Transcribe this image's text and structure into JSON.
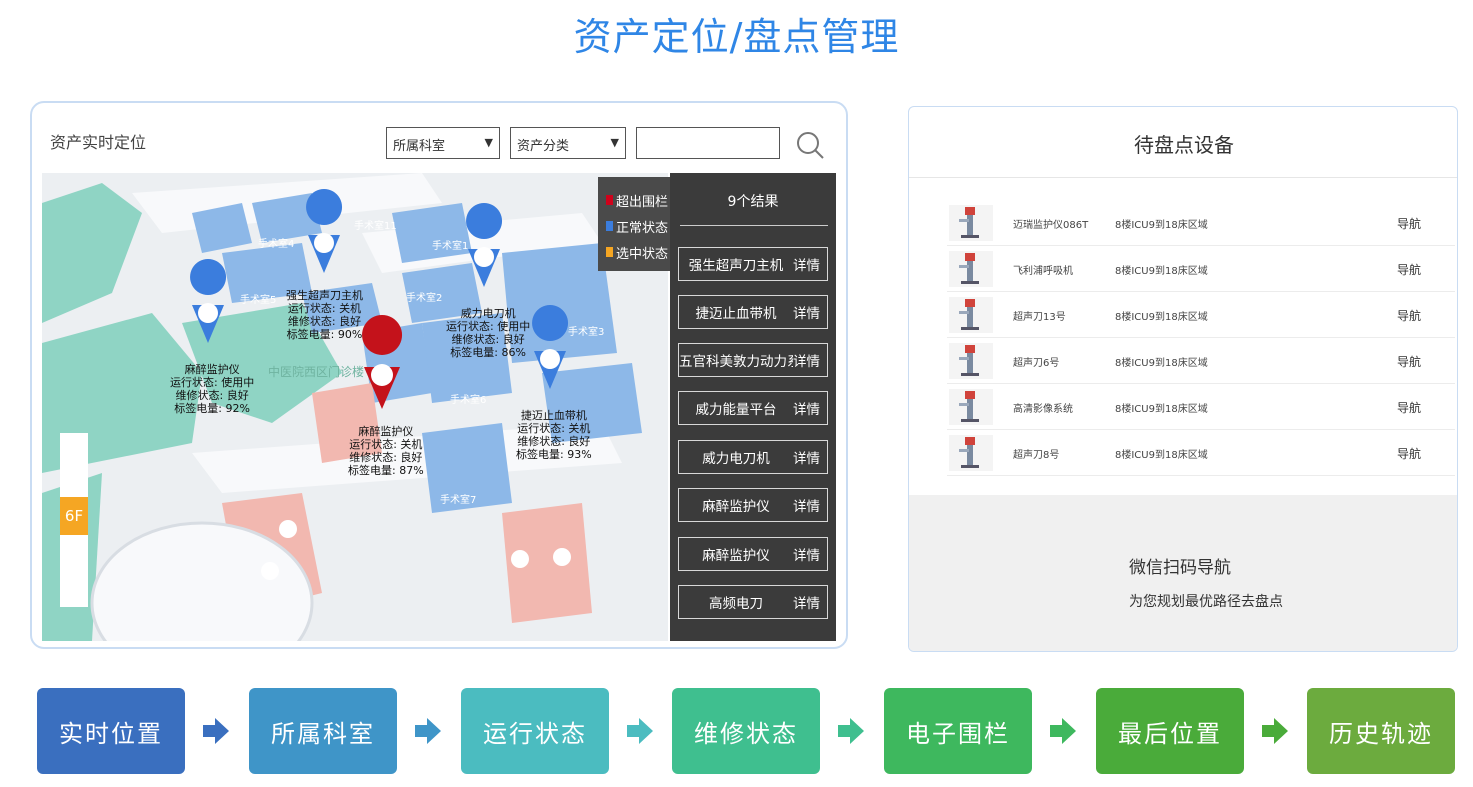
{
  "page_title": "资产定位/盘点管理",
  "map_panel": {
    "label": "资产实时定位",
    "dept_select": "所属科室",
    "category_select": "资产分类",
    "search_value": "",
    "floor": "6F",
    "zone_label": "中医院西区门诊楼",
    "legend": [
      {
        "label": "超出围栏",
        "color": "#d0021b"
      },
      {
        "label": "正常状态",
        "color": "#3b7ddd"
      },
      {
        "label": "选中状态",
        "color": "#f5a623"
      }
    ],
    "results_header": "9个结果",
    "detail_label": "详情",
    "results": [
      "强生超声刀主机",
      "捷迈止血带机",
      "五官科美敦力动力系统",
      "威力能量平台",
      "威力电刀机",
      "麻醉监护仪",
      "麻醉监护仪",
      "高频电刀"
    ],
    "rooms": [
      "手术室1",
      "手术室2",
      "手术室3",
      "手术室4",
      "手术室5",
      "手术室6",
      "手术室7",
      "手术室8",
      "手术室11"
    ],
    "pins": [
      {
        "name": "麻醉监护仪",
        "run": "运行状态: 使用中",
        "repair": "维修状态: 良好",
        "battery": "标签电量: 92%",
        "color": "#3b7ddd"
      },
      {
        "name": "强生超声刀主机",
        "run": "运行状态: 关机",
        "repair": "维修状态: 良好",
        "battery": "标签电量: 90%",
        "color": "#3b7ddd"
      },
      {
        "name": "威力电刀机",
        "run": "运行状态: 使用中",
        "repair": "维修状态: 良好",
        "battery": "标签电量: 86%",
        "color": "#3b7ddd"
      },
      {
        "name": "麻醉监护仪",
        "run": "运行状态: 关机",
        "repair": "维修状态: 良好",
        "battery": "标签电量: 87%",
        "color": "#c4121b"
      },
      {
        "name": "捷迈止血带机",
        "run": "运行状态: 关机",
        "repair": "维修状态: 良好",
        "battery": "标签电量: 93%",
        "color": "#3b7ddd"
      }
    ]
  },
  "inventory": {
    "title": "待盘点设备",
    "nav_label": "导航",
    "rows": [
      {
        "name": "迈瑞监护仪086T",
        "location": "8楼ICU9到18床区域"
      },
      {
        "name": "飞利浦呼吸机",
        "location": "8楼ICU9到18床区域"
      },
      {
        "name": "超声刀13号",
        "location": "8楼ICU9到18床区域"
      },
      {
        "name": "超声刀6号",
        "location": "8楼ICU9到18床区域"
      },
      {
        "name": "高清影像系统",
        "location": "8楼ICU9到18床区域"
      },
      {
        "name": "超声刀8号",
        "location": "8楼ICU9到18床区域"
      }
    ],
    "scan_title": "微信扫码导航",
    "scan_subtitle": "为您规划最优路径去盘点"
  },
  "flow": [
    {
      "label": "实时位置",
      "color": "#3a6fbf"
    },
    {
      "label": "所属科室",
      "color": "#3f95c8"
    },
    {
      "label": "运行状态",
      "color": "#4bbcc0"
    },
    {
      "label": "维修状态",
      "color": "#3fbf8f"
    },
    {
      "label": "电子围栏",
      "color": "#3eb85e"
    },
    {
      "label": "最后位置",
      "color": "#4aab3a"
    },
    {
      "label": "历史轨迹",
      "color": "#6cab3e"
    }
  ],
  "flow_arrow_colors": [
    "#3a6fbf",
    "#3f95c8",
    "#4bbcc0",
    "#3fbf8f",
    "#3eb85e",
    "#4aab3a"
  ]
}
